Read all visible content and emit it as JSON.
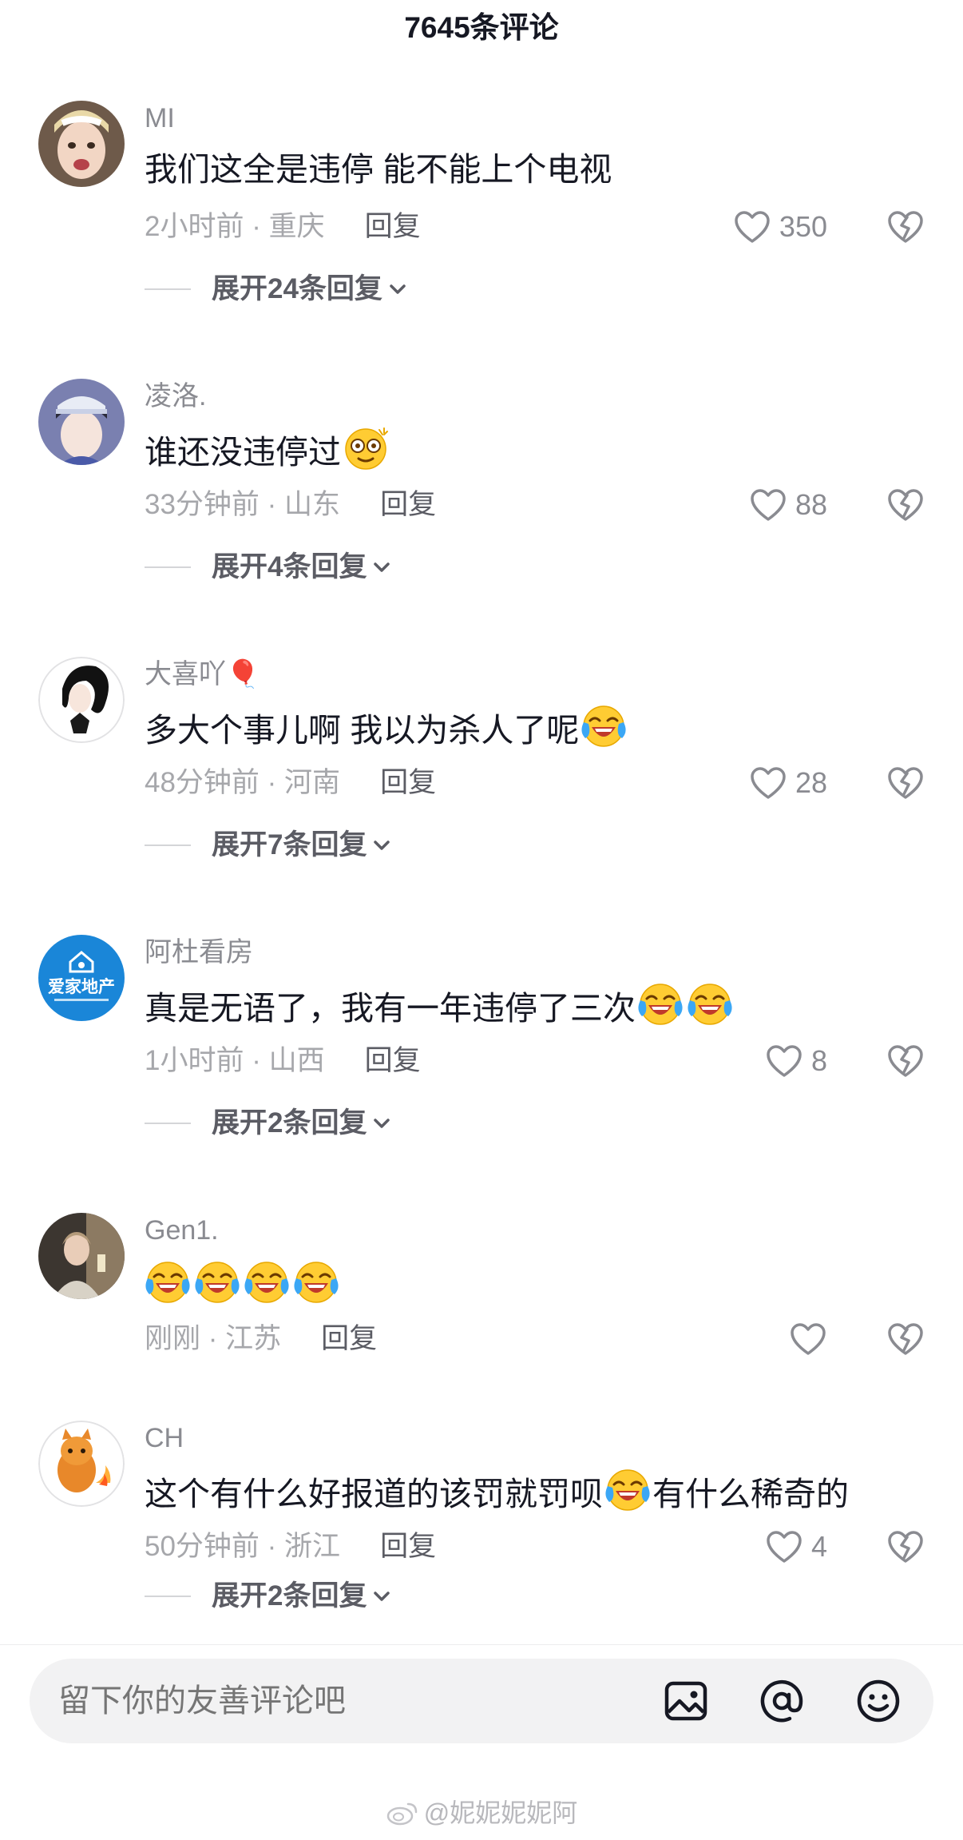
{
  "header": {
    "title": "7645条评论"
  },
  "comments": [
    {
      "username": "MI",
      "text": "我们这全是违停 能不能上个电视",
      "emojis_after": 0,
      "time": "2小时前",
      "location": "重庆",
      "likes": "350",
      "expand": "展开24条回复"
    },
    {
      "username": "凌洛.",
      "text": "谁还没违停过",
      "emojis_after": 1,
      "emoji_type": "dizzy-face",
      "time": "33分钟前",
      "location": "山东",
      "likes": "88",
      "expand": "展开4条回复"
    },
    {
      "username": "大喜吖🎈",
      "text": "多大个事儿啊 我以为杀人了呢",
      "emojis_after": 1,
      "emoji_type": "crying-laugh",
      "time": "48分钟前",
      "location": "河南",
      "likes": "28",
      "expand": "展开7条回复"
    },
    {
      "username": "阿杜看房",
      "text": "真是无语了，我有一年违停了三次",
      "emojis_after": 2,
      "emoji_type": "crying-laugh",
      "time": "1小时前",
      "location": "山西",
      "likes": "8",
      "expand": "展开2条回复",
      "avatar_text": "爱家地产"
    },
    {
      "username": "Gen1.",
      "text": "",
      "emojis_after": 4,
      "emoji_type": "crying-laugh",
      "time": "刚刚",
      "location": "江苏",
      "likes": "",
      "expand": ""
    },
    {
      "username": "CH",
      "text": "这个有什么好报道的该罚就罚呗",
      "text_after": "有什么稀奇的",
      "emojis_after": 1,
      "emoji_type": "crying-laugh",
      "time": "50分钟前",
      "location": "浙江",
      "likes": "4",
      "expand": "展开2条回复"
    }
  ],
  "meta_separator": " · ",
  "reply_label": "回复",
  "input": {
    "placeholder": "留下你的友善评论吧"
  },
  "icons": [
    "image-icon",
    "at-icon",
    "emoji-icon",
    "heart-icon",
    "broken-heart-icon",
    "chevron-down-icon"
  ],
  "watermark": "@妮妮妮妮阿",
  "colors": {
    "text": "#161823",
    "secondary": "#8a8b91",
    "muted": "#a6a7ab",
    "reply": "#5b5c64",
    "input_bg": "#f2f2f3"
  }
}
